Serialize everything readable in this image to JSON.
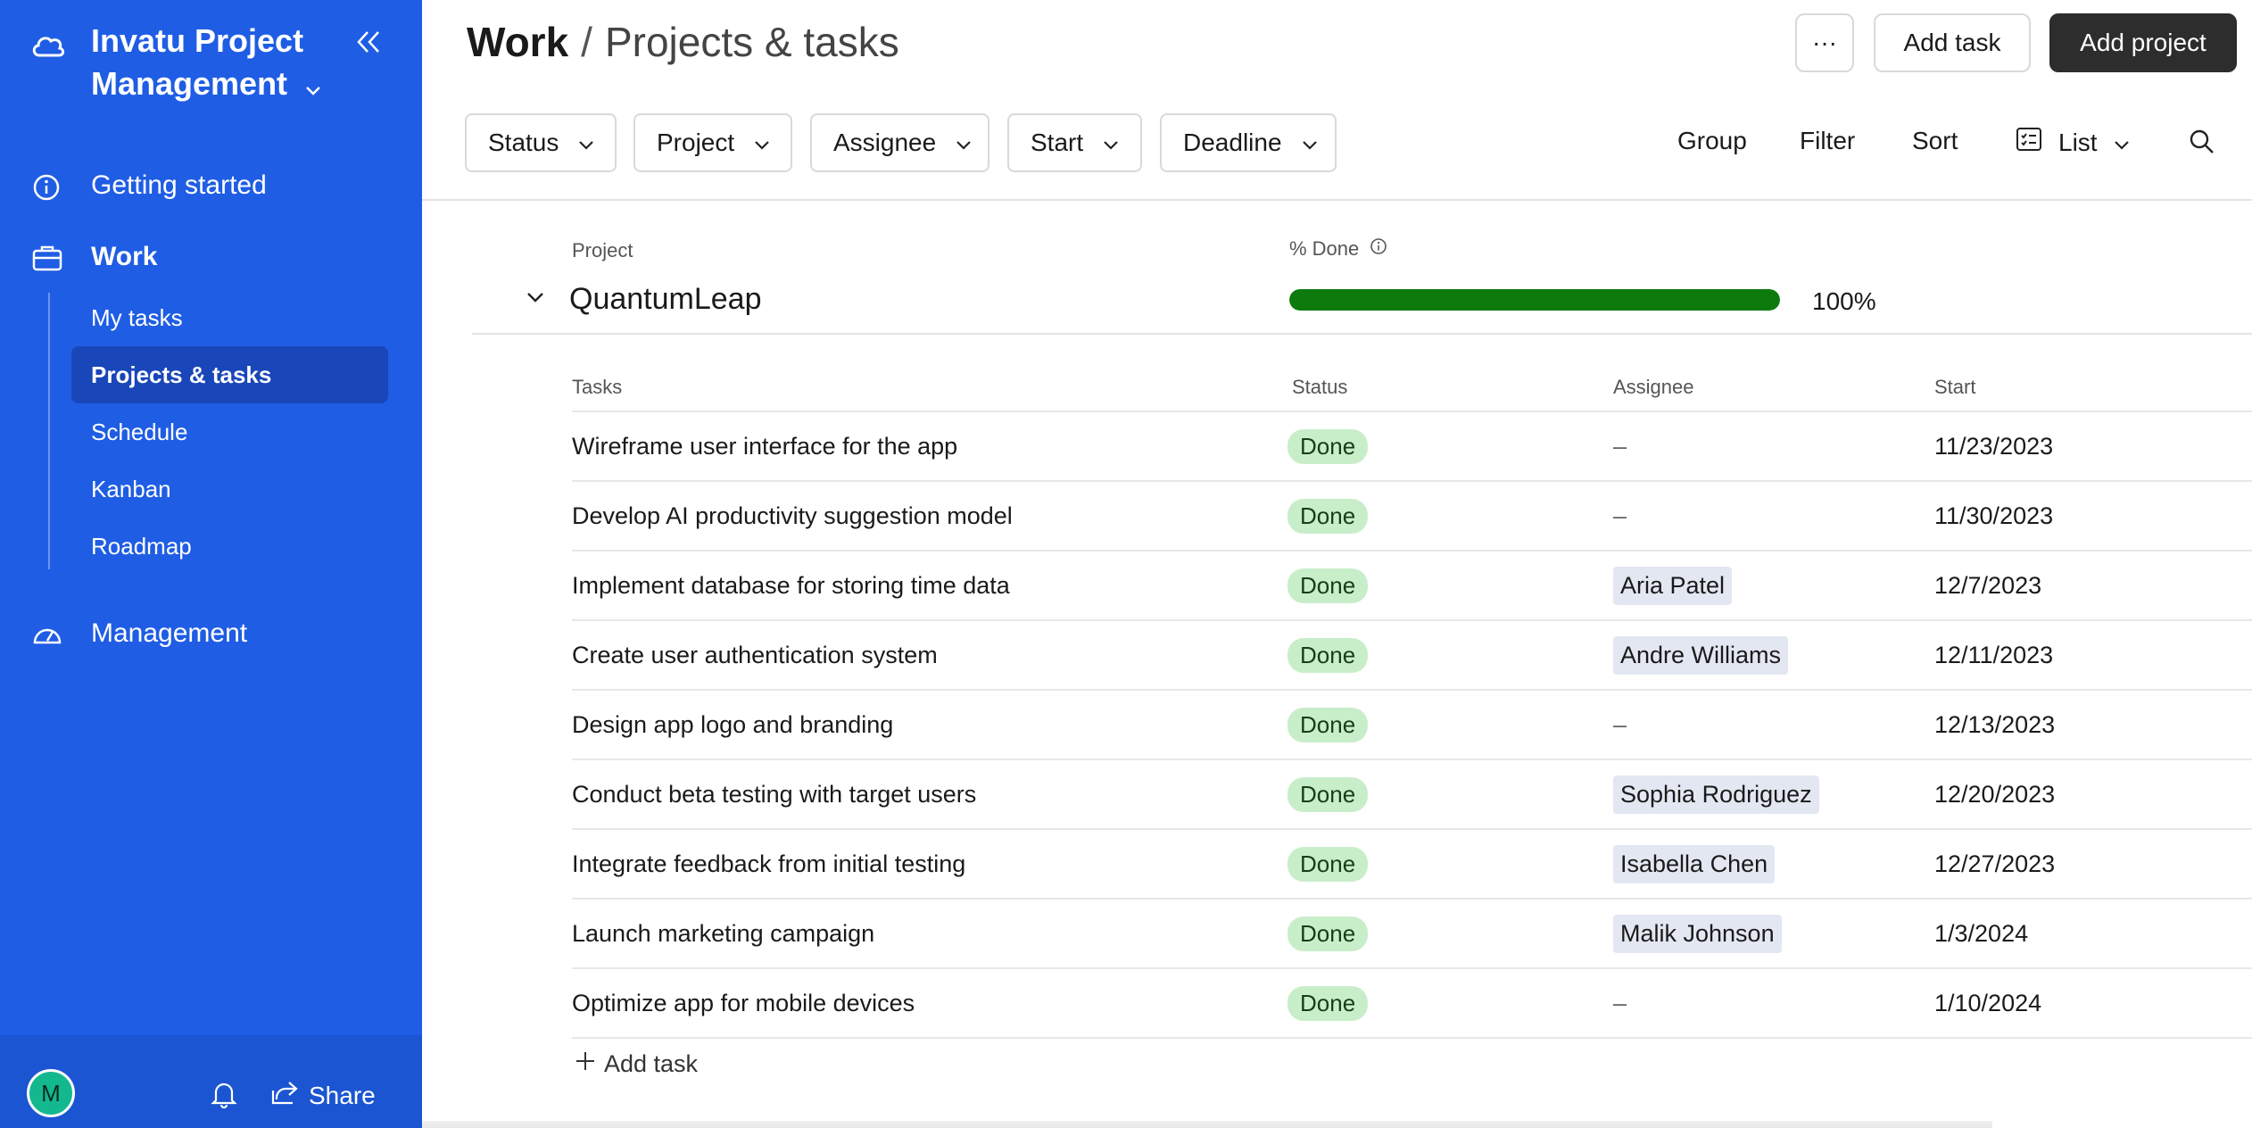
{
  "sidebar": {
    "brand": "Invatu Project Management",
    "nav": {
      "getting_started": "Getting started",
      "work": "Work",
      "management": "Management"
    },
    "sub_items": [
      "My tasks",
      "Projects & tasks",
      "Schedule",
      "Kanban",
      "Roadmap"
    ],
    "active_sub": "Projects & tasks",
    "footer": {
      "avatar_initial": "M",
      "share": "Share"
    }
  },
  "header": {
    "breadcrumb_root": "Work",
    "breadcrumb_sep": "/",
    "breadcrumb_page": "Projects & tasks",
    "more": "···",
    "add_task": "Add task",
    "add_project": "Add project"
  },
  "filters": [
    "Status",
    "Project",
    "Assignee",
    "Start",
    "Deadline"
  ],
  "toolbar": {
    "group": "Group",
    "filter": "Filter",
    "sort": "Sort",
    "view": "List"
  },
  "project_table": {
    "col_project": "Project",
    "col_done": "% Done",
    "project": {
      "name": "QuantumLeap",
      "percent_done": 100,
      "percent_label": "100%"
    },
    "task_columns": [
      "Tasks",
      "Status",
      "Assignee",
      "Start"
    ],
    "tasks": [
      {
        "name": "Wireframe user interface for the app",
        "status": "Done",
        "assignee": "–",
        "start": "11/23/2023"
      },
      {
        "name": "Develop AI productivity suggestion model",
        "status": "Done",
        "assignee": "–",
        "start": "11/30/2023"
      },
      {
        "name": "Implement database for storing time data",
        "status": "Done",
        "assignee": "Aria Patel",
        "start": "12/7/2023"
      },
      {
        "name": "Create user authentication system",
        "status": "Done",
        "assignee": "Andre Williams",
        "start": "12/11/2023"
      },
      {
        "name": "Design app logo and branding",
        "status": "Done",
        "assignee": "–",
        "start": "12/13/2023"
      },
      {
        "name": "Conduct beta testing with target users",
        "status": "Done",
        "assignee": "Sophia Rodriguez",
        "start": "12/20/2023"
      },
      {
        "name": "Integrate feedback from initial testing",
        "status": "Done",
        "assignee": "Isabella Chen",
        "start": "12/27/2023"
      },
      {
        "name": "Launch marketing campaign",
        "status": "Done",
        "assignee": "Malik Johnson",
        "start": "1/3/2024"
      },
      {
        "name": "Optimize app for mobile devices",
        "status": "Done",
        "assignee": "–",
        "start": "1/10/2024"
      }
    ],
    "add_task": "Add task"
  },
  "colors": {
    "sidebar": "#1f5de4",
    "active_item": "#1946b8",
    "progress": "#0e7a0e",
    "done_badge": "#c8eec9"
  }
}
